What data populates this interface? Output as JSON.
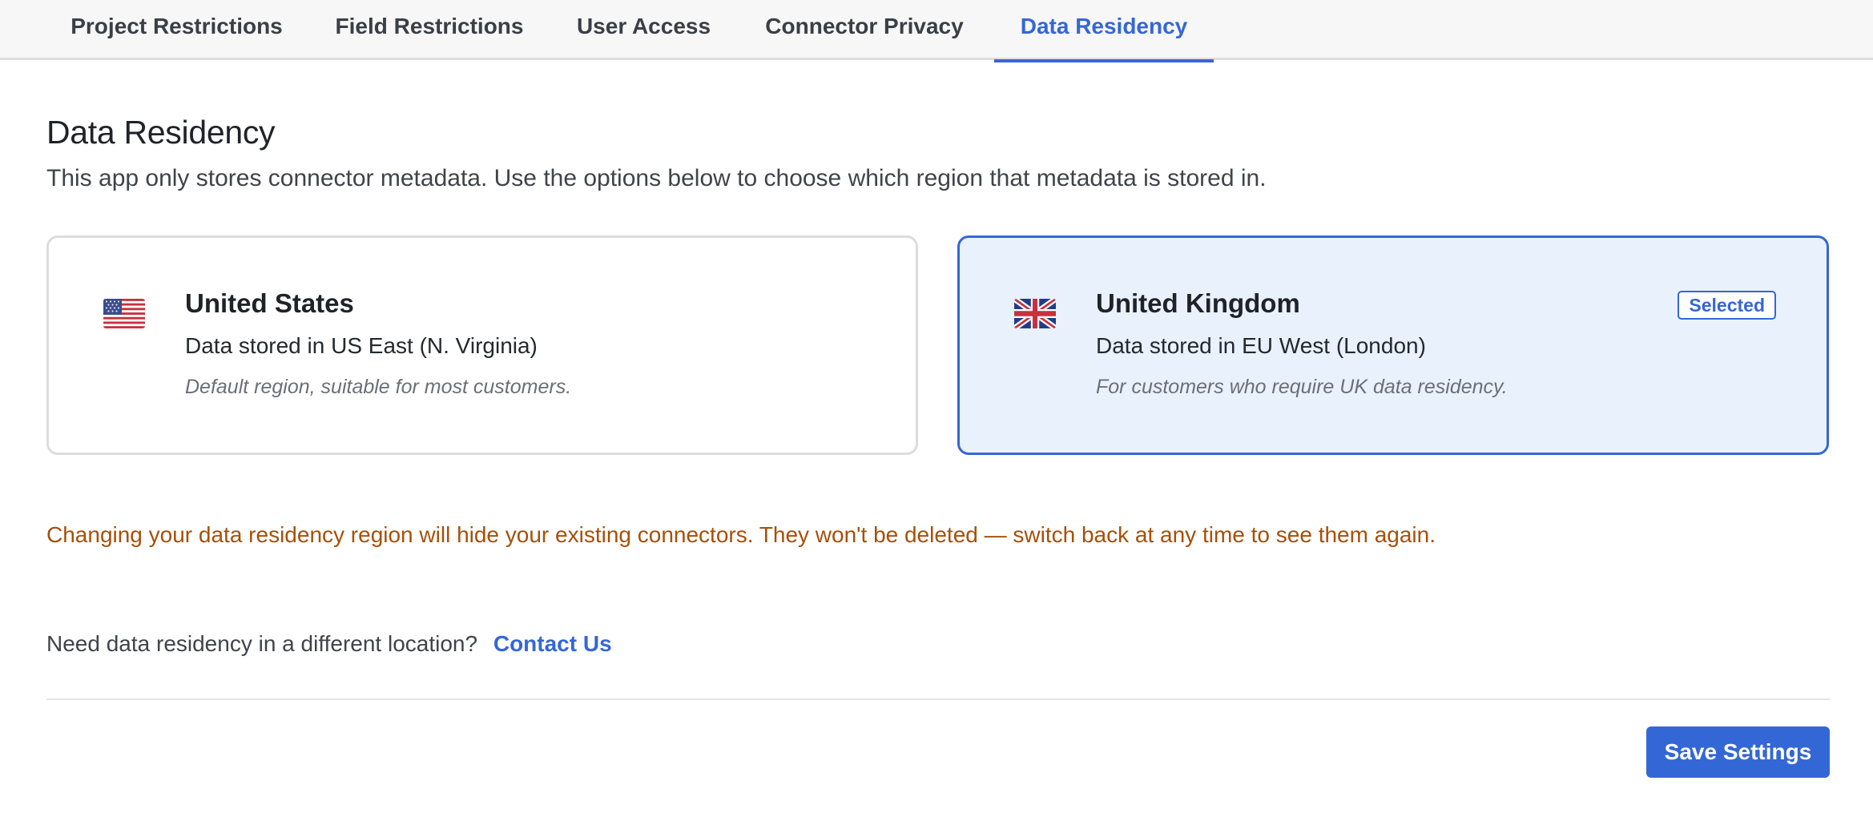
{
  "tabs": [
    {
      "label": "Project Restrictions",
      "active": false
    },
    {
      "label": "Field Restrictions",
      "active": false
    },
    {
      "label": "User Access",
      "active": false
    },
    {
      "label": "Connector Privacy",
      "active": false
    },
    {
      "label": "Data Residency",
      "active": true
    }
  ],
  "page": {
    "title": "Data Residency",
    "description": "This app only stores connector metadata. Use the options below to choose which region that metadata is stored in."
  },
  "regions": [
    {
      "flag_icon": "us-flag-icon",
      "title": "United States",
      "location": "Data stored in US East (N. Virginia)",
      "note": "Default region, suitable for most customers.",
      "selected": false
    },
    {
      "flag_icon": "uk-flag-icon",
      "title": "United Kingdom",
      "location": "Data stored in EU West (London)",
      "note": "For customers who require UK data residency.",
      "selected": true,
      "badge": "Selected"
    }
  ],
  "warning": "Changing your data residency region will hide your existing connectors. They won't be deleted — switch back at any time to see them again.",
  "contact": {
    "prompt": "Need data residency in a different location?",
    "link": "Contact Us"
  },
  "actions": {
    "save_label": "Save Settings"
  },
  "colors": {
    "accent": "#3467d6",
    "selected_bg": "#e9f1fd",
    "warning": "#a5500b"
  }
}
